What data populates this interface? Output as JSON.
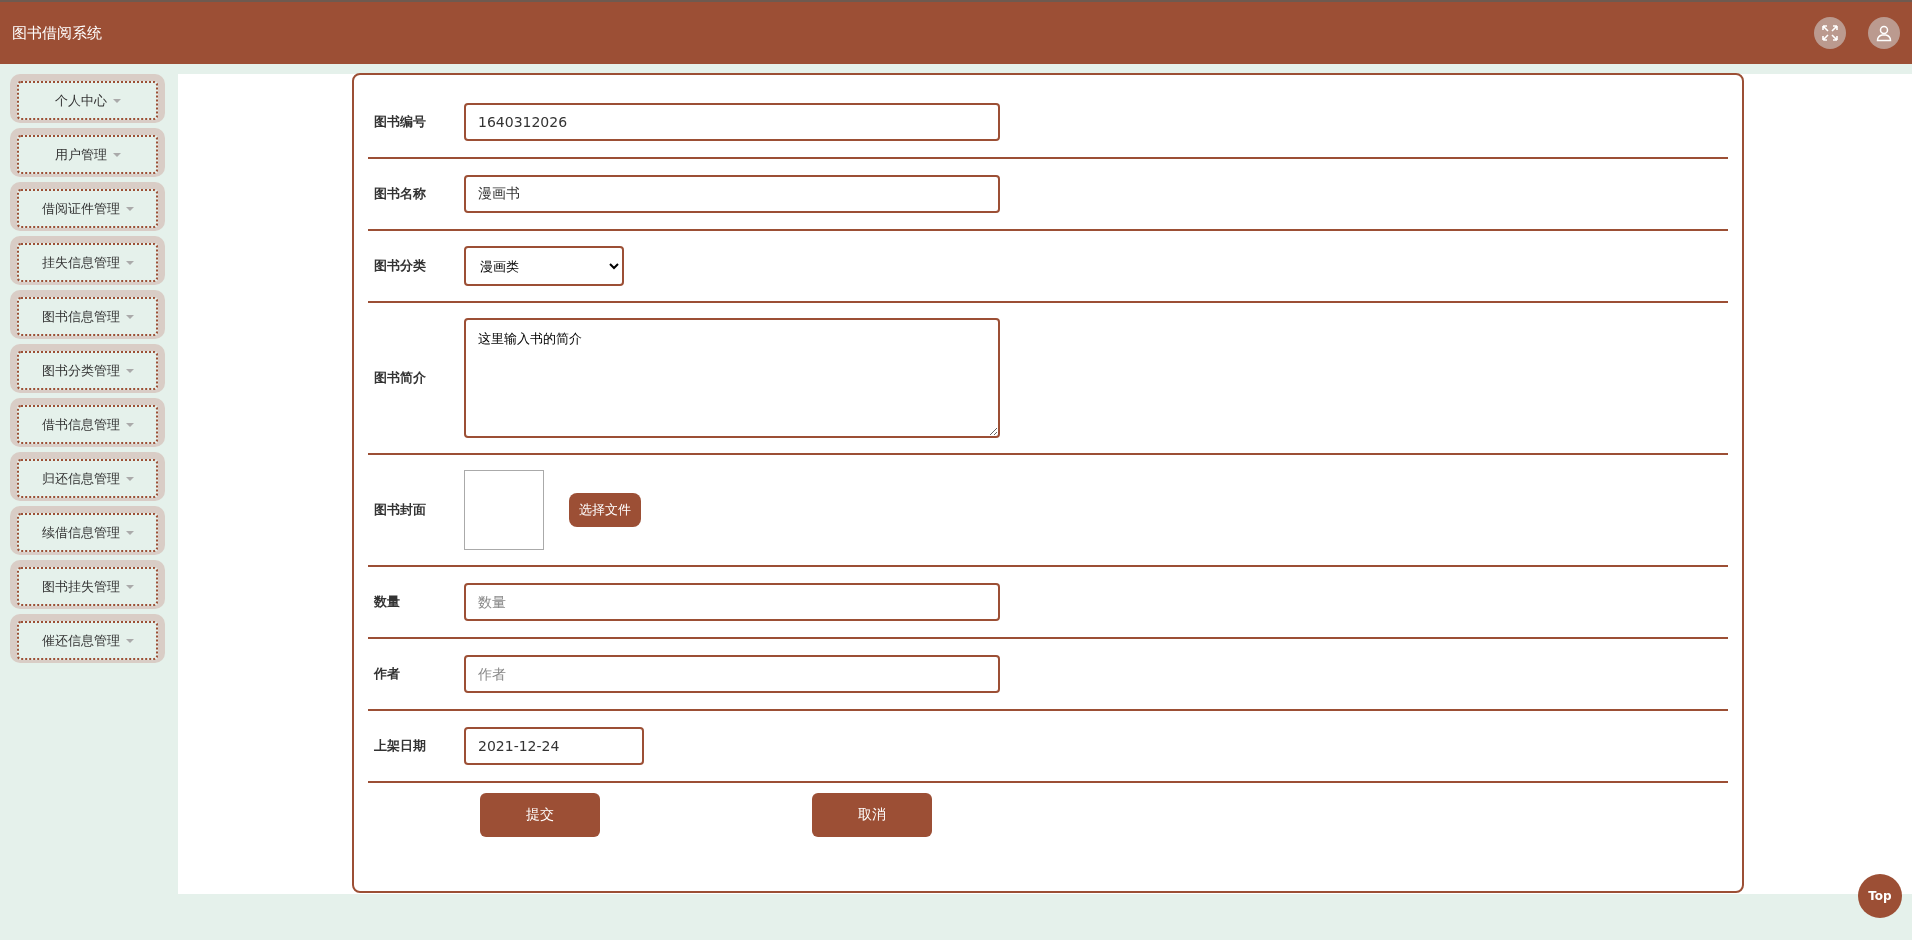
{
  "header": {
    "title": "图书借阅系统"
  },
  "sidebar": {
    "items": [
      {
        "label": "个人中心"
      },
      {
        "label": "用户管理"
      },
      {
        "label": "借阅证件管理"
      },
      {
        "label": "挂失信息管理"
      },
      {
        "label": "图书信息管理"
      },
      {
        "label": "图书分类管理"
      },
      {
        "label": "借书信息管理"
      },
      {
        "label": "归还信息管理"
      },
      {
        "label": "续借信息管理"
      },
      {
        "label": "图书挂失管理"
      },
      {
        "label": "催还信息管理"
      }
    ]
  },
  "form": {
    "fields": [
      {
        "kind": "text",
        "label": "图书编号",
        "value": "1640312026"
      },
      {
        "kind": "text",
        "label": "图书名称",
        "value": "漫画书"
      },
      {
        "kind": "select",
        "label": "图书分类",
        "value": "漫画类"
      },
      {
        "kind": "textarea",
        "label": "图书简介",
        "value": "这里输入书的简介"
      },
      {
        "kind": "image",
        "label": "图书封面",
        "button": "选择文件"
      },
      {
        "kind": "text",
        "label": "数量",
        "placeholder": "数量"
      },
      {
        "kind": "text",
        "label": "作者",
        "placeholder": "作者"
      },
      {
        "kind": "date",
        "label": "上架日期",
        "value": "2021-12-24"
      }
    ],
    "buttons": [
      "提交",
      "取消"
    ]
  },
  "back_to_top": "Top"
}
